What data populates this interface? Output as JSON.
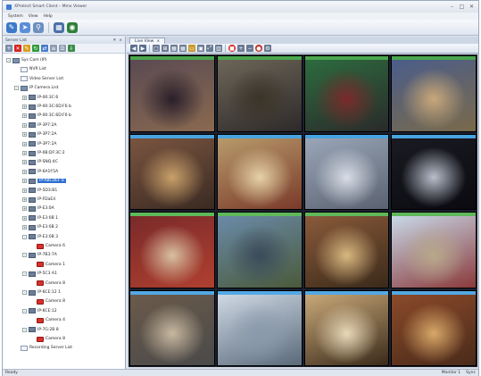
{
  "app": {
    "title": "XProtect Smart Client – Mmx Viewer"
  },
  "menu": {
    "items": [
      "System",
      "View",
      "Help"
    ]
  },
  "toolbar": {
    "icons": [
      {
        "name": "edit-icon",
        "glyph": "✎",
        "color": "#3b78c8"
      },
      {
        "name": "arrow-icon",
        "glyph": "➤",
        "color": "#5a8fd8"
      },
      {
        "name": "search-icon",
        "glyph": "⚲",
        "color": "#6c8fbf"
      },
      {
        "name": "grid-icon",
        "glyph": "▦",
        "color": "#4a6ea8"
      },
      {
        "name": "camera-icon",
        "glyph": "◉",
        "color": "#2f7e3a"
      }
    ]
  },
  "left_panel": {
    "header": "Server List"
  },
  "tree": {
    "rows": [
      {
        "label": "Sys Cam (IP)",
        "icon": "folder",
        "level": 0,
        "expander": "-"
      },
      {
        "label": "NVR List",
        "icon": "doc",
        "level": 1,
        "expander": ""
      },
      {
        "label": "Video Server List",
        "icon": "doc",
        "level": 1,
        "expander": ""
      },
      {
        "label": "IP Camera List",
        "icon": "folder",
        "level": 1,
        "expander": "-"
      },
      {
        "label": "IP-00:3C:6",
        "icon": "server",
        "level": 2,
        "expander": "+"
      },
      {
        "label": "IP-00:3C:6D:F6 b",
        "icon": "server",
        "level": 2,
        "expander": "+"
      },
      {
        "label": "IP-00:3C:6D:F6 b",
        "icon": "server",
        "level": 2,
        "expander": "+"
      },
      {
        "label": "IP-3P7:2A",
        "icon": "server",
        "level": 2,
        "expander": "+"
      },
      {
        "label": "IP-3P7:2A",
        "icon": "server",
        "level": 2,
        "expander": "+"
      },
      {
        "label": "IP-3P7:2A",
        "icon": "server",
        "level": 2,
        "expander": "+"
      },
      {
        "label": "IP-0B:DF:3C:2",
        "icon": "server",
        "level": 2,
        "expander": "+"
      },
      {
        "label": "IP-SNQ:4C",
        "icon": "server",
        "level": 2,
        "expander": "+"
      },
      {
        "label": "IP-6A1f:5A",
        "icon": "server",
        "level": 2,
        "expander": "+"
      },
      {
        "label": "IP-ABCDEF b",
        "icon": "server",
        "level": 2,
        "expander": "+",
        "selected": true
      },
      {
        "label": "IP-5D3:B1",
        "icon": "server",
        "level": 2,
        "expander": "+"
      },
      {
        "label": "IP-FDaE4",
        "icon": "server",
        "level": 2,
        "expander": "+"
      },
      {
        "label": "IP-E3:0A",
        "icon": "server",
        "level": 2,
        "expander": "+"
      },
      {
        "label": "IP-E3:0B 1",
        "icon": "server",
        "level": 2,
        "expander": "+"
      },
      {
        "label": "IP-E3:0B 2",
        "icon": "server",
        "level": 2,
        "expander": "+"
      },
      {
        "label": "IP-E3:0B 3",
        "icon": "server",
        "level": 2,
        "expander": "-"
      },
      {
        "label": "Camera 6",
        "icon": "cam",
        "level": 3,
        "expander": ""
      },
      {
        "label": "IP-7B3:7A",
        "icon": "server",
        "level": 2,
        "expander": "-"
      },
      {
        "label": "Camera 1",
        "icon": "cam",
        "level": 3,
        "expander": ""
      },
      {
        "label": "IP-5C3 A1",
        "icon": "server",
        "level": 2,
        "expander": "-"
      },
      {
        "label": "Camera 8",
        "icon": "cam",
        "level": 3,
        "expander": ""
      },
      {
        "label": "IP-6CE:12 1",
        "icon": "server",
        "level": 2,
        "expander": "-"
      },
      {
        "label": "Camera 8",
        "icon": "cam",
        "level": 3,
        "expander": ""
      },
      {
        "label": "IP-6CE:12",
        "icon": "server",
        "level": 2,
        "expander": "-"
      },
      {
        "label": "Camera 4",
        "icon": "cam",
        "level": 3,
        "expander": ""
      },
      {
        "label": "IP-7G:2B 8",
        "icon": "server",
        "level": 2,
        "expander": "-"
      },
      {
        "label": "Camera 8",
        "icon": "cam",
        "level": 3,
        "expander": ""
      },
      {
        "label": "Recording Server List",
        "icon": "doc",
        "level": 1,
        "expander": ""
      }
    ]
  },
  "tabs": [
    {
      "label": "Live View"
    }
  ],
  "cam_toolbar": {
    "icons": [
      {
        "name": "back-icon",
        "glyph": "◀",
        "color": "#5a6e8c"
      },
      {
        "name": "forward-icon",
        "glyph": "▶",
        "color": "#5a6e8c"
      },
      {
        "name": "layout-1-icon",
        "glyph": "□",
        "color": "#6a7a94"
      },
      {
        "name": "layout-4-icon",
        "glyph": "⊞",
        "color": "#6a7a94"
      },
      {
        "name": "layout-9-icon",
        "glyph": "▦",
        "color": "#6a7a94"
      },
      {
        "name": "layout-16-icon",
        "glyph": "▦",
        "color": "#6a7a94"
      },
      {
        "name": "folder-icon",
        "glyph": "▭",
        "color": "#c99a2e"
      },
      {
        "name": "snapshot-icon",
        "glyph": "▣",
        "color": "#6a7a94"
      },
      {
        "name": "fullscreen-icon",
        "glyph": "⤢",
        "color": "#6a7a94"
      },
      {
        "name": "split-icon",
        "glyph": "▥",
        "color": "#6a7a94"
      },
      {
        "name": "stop-icon",
        "glyph": "■",
        "color": "#d8231d",
        "round": true
      },
      {
        "name": "zoom-in-icon",
        "glyph": "+",
        "color": "#6a7a94"
      },
      {
        "name": "zoom-out-icon",
        "glyph": "−",
        "color": "#6a7a94"
      },
      {
        "name": "record-icon",
        "glyph": "●",
        "color": "#c0302a",
        "round": true
      },
      {
        "name": "settings-icon",
        "glyph": "⚙",
        "color": "#6a7a94"
      }
    ]
  },
  "cameras": [
    {
      "label": "",
      "bar": "#4aa84e",
      "bg": [
        "#5a4a52",
        "#2a1f2a",
        "#8a6a50"
      ]
    },
    {
      "label": "",
      "bar": "#4aa84e",
      "bg": [
        "#6d6558",
        "#3a3428",
        "#2d2a2a"
      ]
    },
    {
      "label": "",
      "bar": "#4aa84e",
      "bg": [
        "#2d6b3f",
        "#7a2a2a",
        "#2a2a2a"
      ]
    },
    {
      "label": "",
      "bar": "#4aa84e",
      "bg": [
        "#4a5d8a",
        "#c9a87a",
        "#7a6a4a"
      ]
    },
    {
      "label": "",
      "bar": "#48a4e0",
      "bg": [
        "#7a5540",
        "#c9a06a",
        "#3a2a22"
      ]
    },
    {
      "label": "",
      "bar": "#48a4e0",
      "bg": [
        "#b79a6a",
        "#e6d2a8",
        "#7a3a2a"
      ]
    },
    {
      "label": "",
      "bar": "#48a4e0",
      "bg": [
        "#9aa6b8",
        "#d8dde6",
        "#5a6270"
      ]
    },
    {
      "label": "",
      "bar": "#48a4e0",
      "bg": [
        "#1a1a22",
        "#b8c0cc",
        "#0a0a10"
      ]
    },
    {
      "label": "",
      "bar": "#5fb85a",
      "bg": [
        "#7a2a2a",
        "#d8c0a0",
        "#b04030"
      ]
    },
    {
      "label": "",
      "bar": "#5fb85a",
      "bg": [
        "#6a8aa8",
        "#3a4a5a",
        "#4a5a3a"
      ]
    },
    {
      "label": "",
      "bar": "#5fb85a",
      "bg": [
        "#8a5a3a",
        "#d8b880",
        "#3a2a1a"
      ]
    },
    {
      "label": "",
      "bar": "#5fb85a",
      "bg": [
        "#c8d8e8",
        "#b8a88a",
        "#8a3a3a"
      ]
    },
    {
      "label": "",
      "bar": "#52a8e4",
      "bg": [
        "#6a5a4a",
        "#c8b8a0",
        "#4a4a4a"
      ]
    },
    {
      "label": "",
      "bar": "#52a8e4",
      "bg": [
        "#cfd8e4",
        "#8a9aac",
        "#5a6a7a"
      ]
    },
    {
      "label": "",
      "bar": "#52a8e4",
      "bg": [
        "#c8a878",
        "#e8d8b8",
        "#3a2a1a"
      ]
    },
    {
      "label": "",
      "bar": "#52a8e4",
      "bg": [
        "#8a4a2a",
        "#d8a868",
        "#4a2a1a"
      ]
    }
  ],
  "status": {
    "left": "Ready",
    "right": [
      "Monitor 1",
      "Sync"
    ]
  }
}
